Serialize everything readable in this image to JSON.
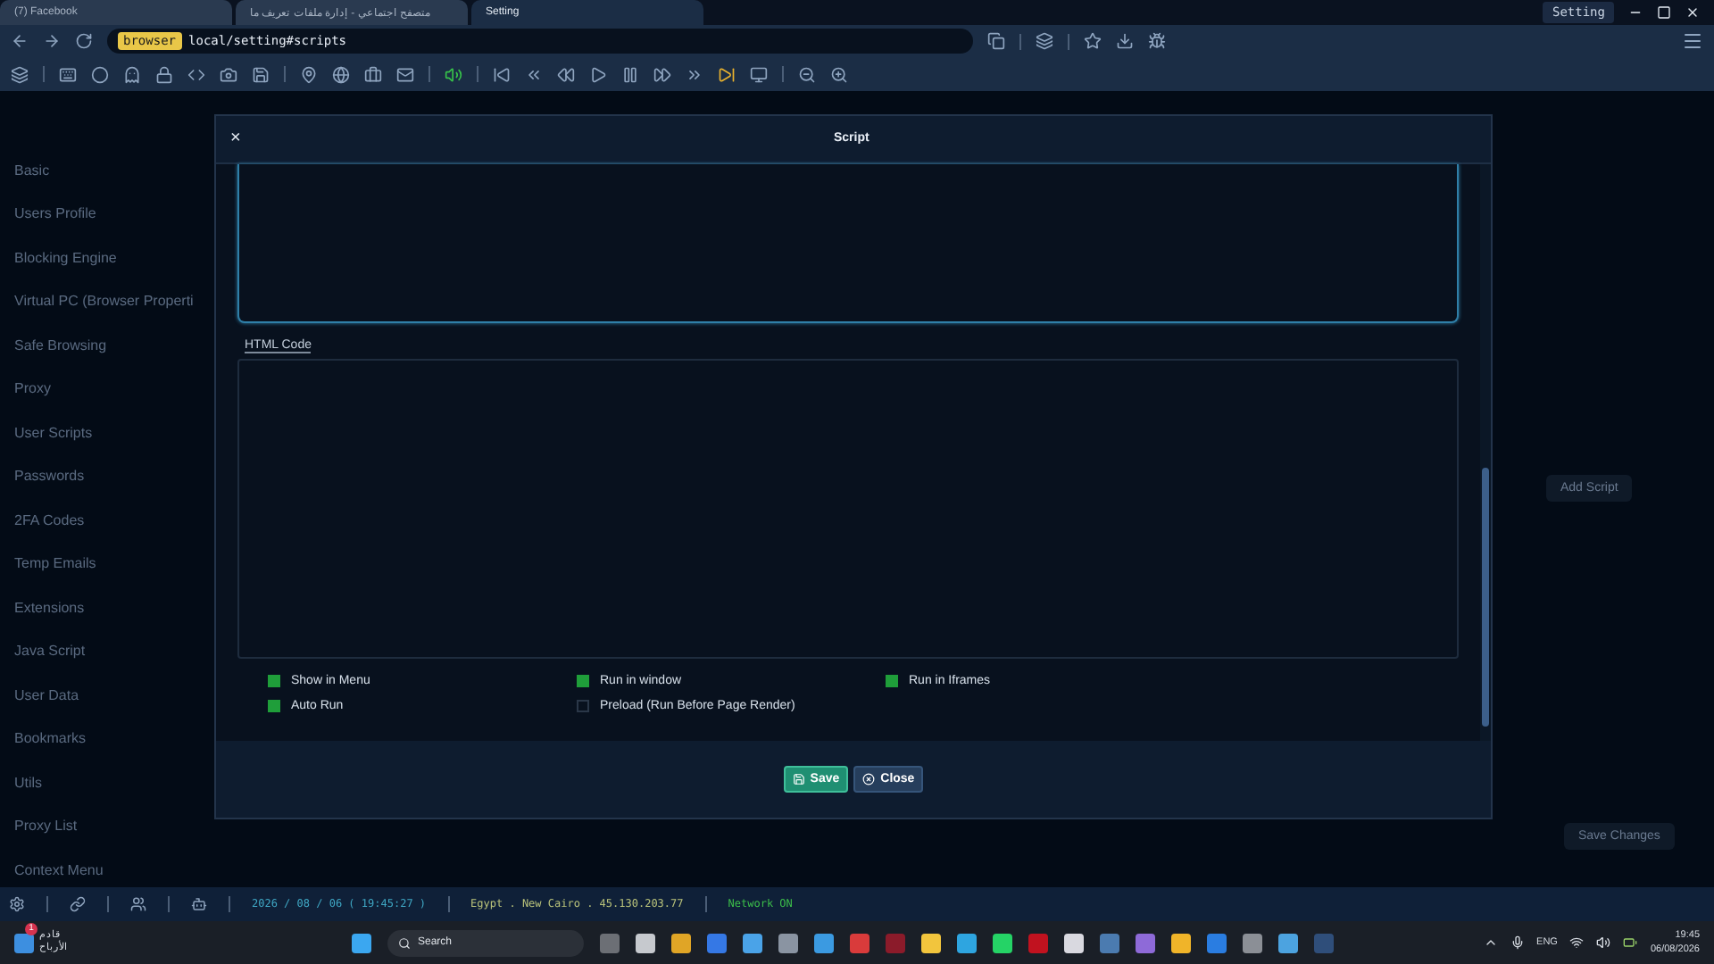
{
  "tabs": [
    {
      "label": "(7) Facebook",
      "selected": false
    },
    {
      "label": "متصفح اجتماعي - إدارة ملفات تعريف ما",
      "selected": false
    },
    {
      "label": "Setting",
      "selected": true
    }
  ],
  "window_badge": "Setting",
  "address": {
    "tag": "browser",
    "url": "local/setting#scripts"
  },
  "sidebar": {
    "items": [
      "Basic",
      "Users Profile",
      "Blocking Engine",
      "Virtual PC (Browser Properti",
      "Safe Browsing",
      "Proxy",
      "User Scripts",
      "Passwords",
      "2FA Codes",
      "Temp Emails",
      "Extensions",
      "Java Script",
      "User Data",
      "Bookmarks",
      "Utils",
      "Proxy List",
      "Context Menu"
    ]
  },
  "background_buttons": {
    "add": "Add Script",
    "save": "Save Changes"
  },
  "dialog": {
    "title": "Script",
    "close": "×",
    "code_label": "HTML Code",
    "options": [
      {
        "label": "Show in Menu",
        "checked": true
      },
      {
        "label": "Run in window",
        "checked": true
      },
      {
        "label": "Run in Iframes",
        "checked": true
      },
      {
        "label": "Auto Run",
        "checked": true
      },
      {
        "label": "Preload (Run Before Page Render)",
        "checked": false
      }
    ],
    "buttons": [
      {
        "label": "Save",
        "kind": "primary"
      },
      {
        "label": "Close",
        "kind": "secondary"
      }
    ]
  },
  "status_bar": {
    "datetime": "2026 / 08 / 06 ( 19:45:27 )",
    "location": "Egypt . New Cairo . 45.130.203.77",
    "network": "Network ON"
  },
  "taskbar": {
    "widget_badge": "1",
    "widget_line1": "قادم",
    "widget_line2": "الأرباح",
    "search": "Search",
    "language": "ENG",
    "time": "19:45",
    "date": "06/08/2026"
  }
}
